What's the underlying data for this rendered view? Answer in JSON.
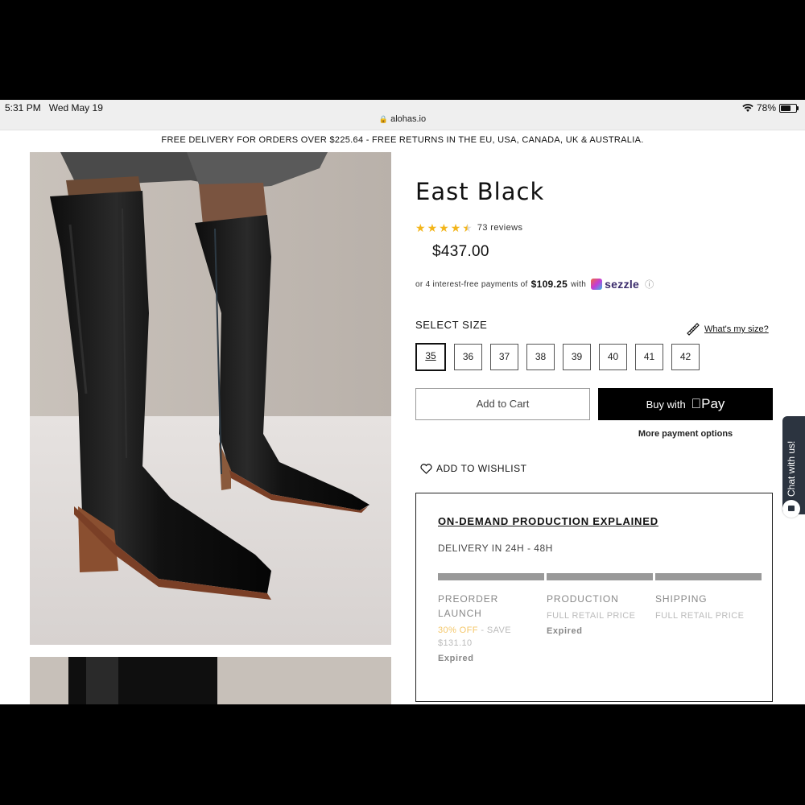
{
  "status_bar": {
    "time": "5:31 PM",
    "date": "Wed May 19",
    "battery": "78%",
    "battery_level": 0.78,
    "url": "alohas.io"
  },
  "promo_banner": "FREE DELIVERY FOR ORDERS OVER $225.64 - FREE RETURNS IN THE EU, USA, CANADA, UK & AUSTRALIA.",
  "product": {
    "title": "East Black",
    "rating": 4.5,
    "reviews": "73 reviews",
    "price": "$437.00",
    "installments_prefix": "or 4 interest-free payments of",
    "installment_amount": "$109.25",
    "installments_with": "with",
    "sezzle": "sezzle"
  },
  "size": {
    "label": "SELECT SIZE",
    "guide_link": "What's my size?",
    "options": [
      "35",
      "36",
      "37",
      "38",
      "39",
      "40",
      "41",
      "42"
    ],
    "selected": "35"
  },
  "actions": {
    "add_to_cart": "Add to Cart",
    "buy_with": "Buy with",
    "pay": "Pay",
    "more_payment": "More payment options",
    "wishlist": "ADD TO WISHLIST"
  },
  "on_demand": {
    "title": "ON-DEMAND PRODUCTION EXPLAINED",
    "delivery": "DELIVERY IN 24H - 48H",
    "stages": [
      {
        "name": "PREORDER LAUNCH",
        "off": "30% OFF",
        "detail": "- SAVE $131.10",
        "status": "Expired"
      },
      {
        "name": "PRODUCTION",
        "detail": "FULL RETAIL PRICE",
        "status": "Expired"
      },
      {
        "name": "SHIPPING",
        "detail": "FULL RETAIL PRICE",
        "status": ""
      }
    ]
  },
  "chat": {
    "label": "Chat with us!"
  },
  "colors": {
    "star": "#f3b51a",
    "discount": "#f4c76a",
    "chat_bg": "#2c3440",
    "button_black": "#000000"
  }
}
